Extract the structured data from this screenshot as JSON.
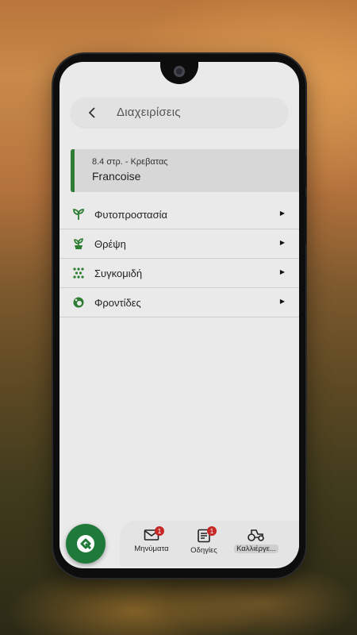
{
  "header": {
    "back_icon": "chevron-left-icon",
    "title": "Διαχειρίσεις"
  },
  "selection": {
    "subtitle": "8.4 στρ. - Κρεβατας",
    "title": "Francoise",
    "accent_color": "#2e7d32"
  },
  "menu": {
    "items": [
      {
        "label": "Φυτοπροστασία",
        "icon": "sprout-icon"
      },
      {
        "label": "Θρέψη",
        "icon": "potted-plant-icon"
      },
      {
        "label": "Συγκομιδή",
        "icon": "harvest-dots-icon"
      },
      {
        "label": "Φροντίδες",
        "icon": "care-icon"
      }
    ]
  },
  "bottom_nav": {
    "fab_icon": "logo-q-icon",
    "fab_color": "#1f7a3a",
    "items": [
      {
        "label": "Μηνύματα",
        "icon": "mail-icon",
        "badge": "1"
      },
      {
        "label": "Οδηγίες",
        "icon": "document-icon",
        "badge": "1"
      },
      {
        "label": "Καλλιέργε...",
        "icon": "tractor-icon",
        "badge": ""
      }
    ]
  }
}
